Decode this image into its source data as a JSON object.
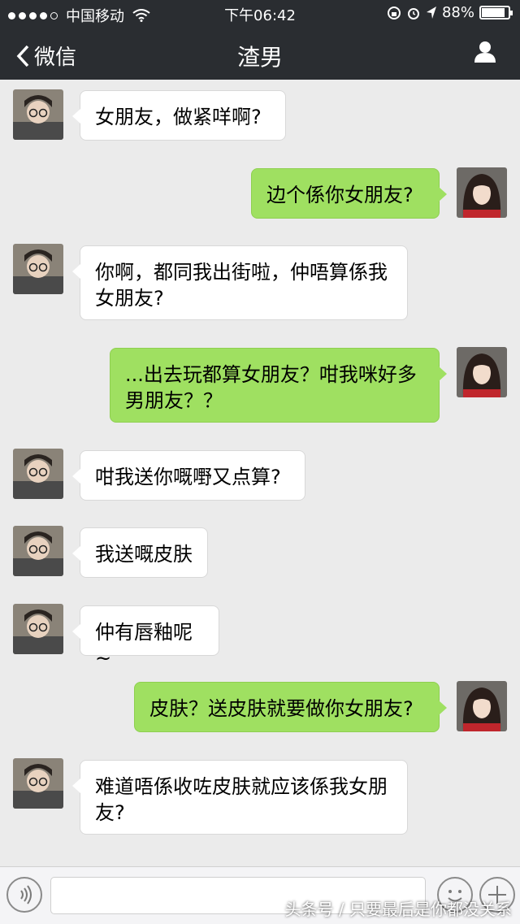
{
  "status_bar": {
    "carrier": "中国移动",
    "time": "下午06:42",
    "battery": "88%",
    "battery_level": 0.88
  },
  "nav": {
    "back_label": "微信",
    "title": "渣男"
  },
  "messages": [
    {
      "side": "left",
      "sender": "渣男",
      "text": "女朋友，做紧咩啊?"
    },
    {
      "side": "right",
      "sender": "me",
      "text": "边个係你女朋友?"
    },
    {
      "side": "left",
      "sender": "渣男",
      "text": "你啊，都同我出街啦，仲唔算係我女朋友?"
    },
    {
      "side": "right",
      "sender": "me",
      "text": "...出去玩都算女朋友？咁我咪好多男朋友？？"
    },
    {
      "side": "left",
      "sender": "渣男",
      "text": "咁我送你嘅嘢又点算?"
    },
    {
      "side": "left",
      "sender": "渣男",
      "text": "我送嘅皮肤"
    },
    {
      "side": "left",
      "sender": "渣男",
      "text": "仲有唇釉呢~"
    },
    {
      "side": "right",
      "sender": "me",
      "text": "皮肤？送皮肤就要做你女朋友?"
    },
    {
      "side": "left",
      "sender": "渣男",
      "text": "难道唔係收咗皮肤就应该係我女朋友?"
    }
  ],
  "input_bar": {
    "voice_icon": "voice-icon",
    "emoji_icon": "emoji-icon",
    "plus_icon": "plus-icon"
  },
  "watermark": "头条号 / 只要最后是你都没关系",
  "colors": {
    "nav_bg": "#2a2d31",
    "chat_bg": "#ebebeb",
    "bubble_me": "#9fe061",
    "bubble_other": "#ffffff"
  }
}
